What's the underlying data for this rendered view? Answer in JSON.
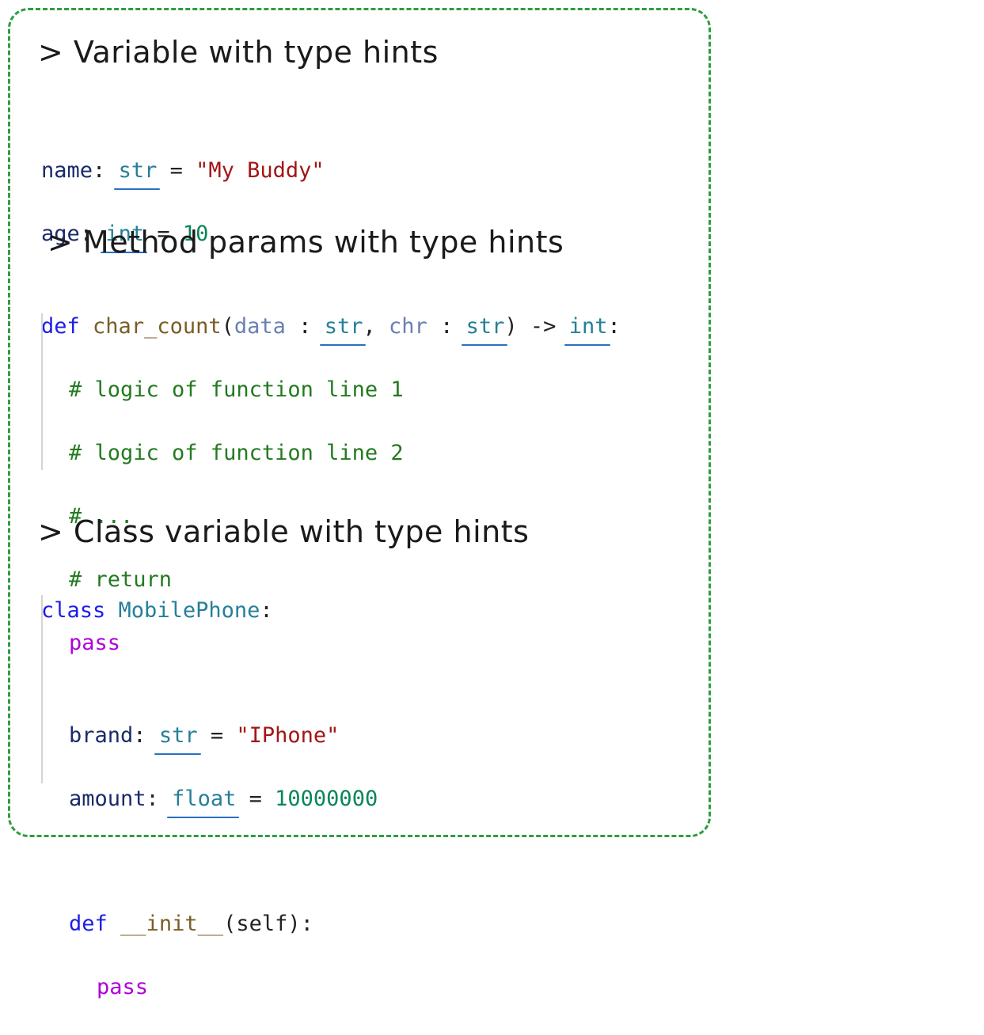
{
  "headings": {
    "h1": "> Variable with type hints",
    "h2": "> Method params with type hints",
    "h3": "> Class variable with type hints"
  },
  "block1": {
    "l1": {
      "name": "name",
      "colon": ":",
      "type": "str",
      "eq": " = ",
      "value": "\"My Buddy\""
    },
    "l2": {
      "name": "age",
      "colon": ":",
      "type": "int",
      "eq": " = ",
      "value": "10"
    }
  },
  "block2": {
    "def": "def",
    "fname": "char_count",
    "open": "(",
    "p1": "data",
    "p1colon": ":",
    "p1type": "str",
    "comma": ",",
    "p2": "chr",
    "p2colon": ":",
    "p2type": "str",
    "close": ")",
    "arrow": "->",
    "ret": "int",
    "endcolon": ":",
    "c1": "# logic of function line 1",
    "c2": "# logic of function line 2",
    "c3": "# ...",
    "c4": "# return",
    "pass": "pass"
  },
  "block3": {
    "class_kw": "class",
    "class_name": "MobilePhone",
    "class_colon": ":",
    "brand": "brand",
    "brand_type": "str",
    "brand_val": "\"IPhone\"",
    "amount": "amount",
    "amount_type": "float",
    "amount_val": "10000000",
    "colon": ":",
    "eq": "=",
    "def": "def",
    "init": "__init__",
    "self_args": "(self)",
    "init_colon": ":",
    "pass": "pass"
  }
}
